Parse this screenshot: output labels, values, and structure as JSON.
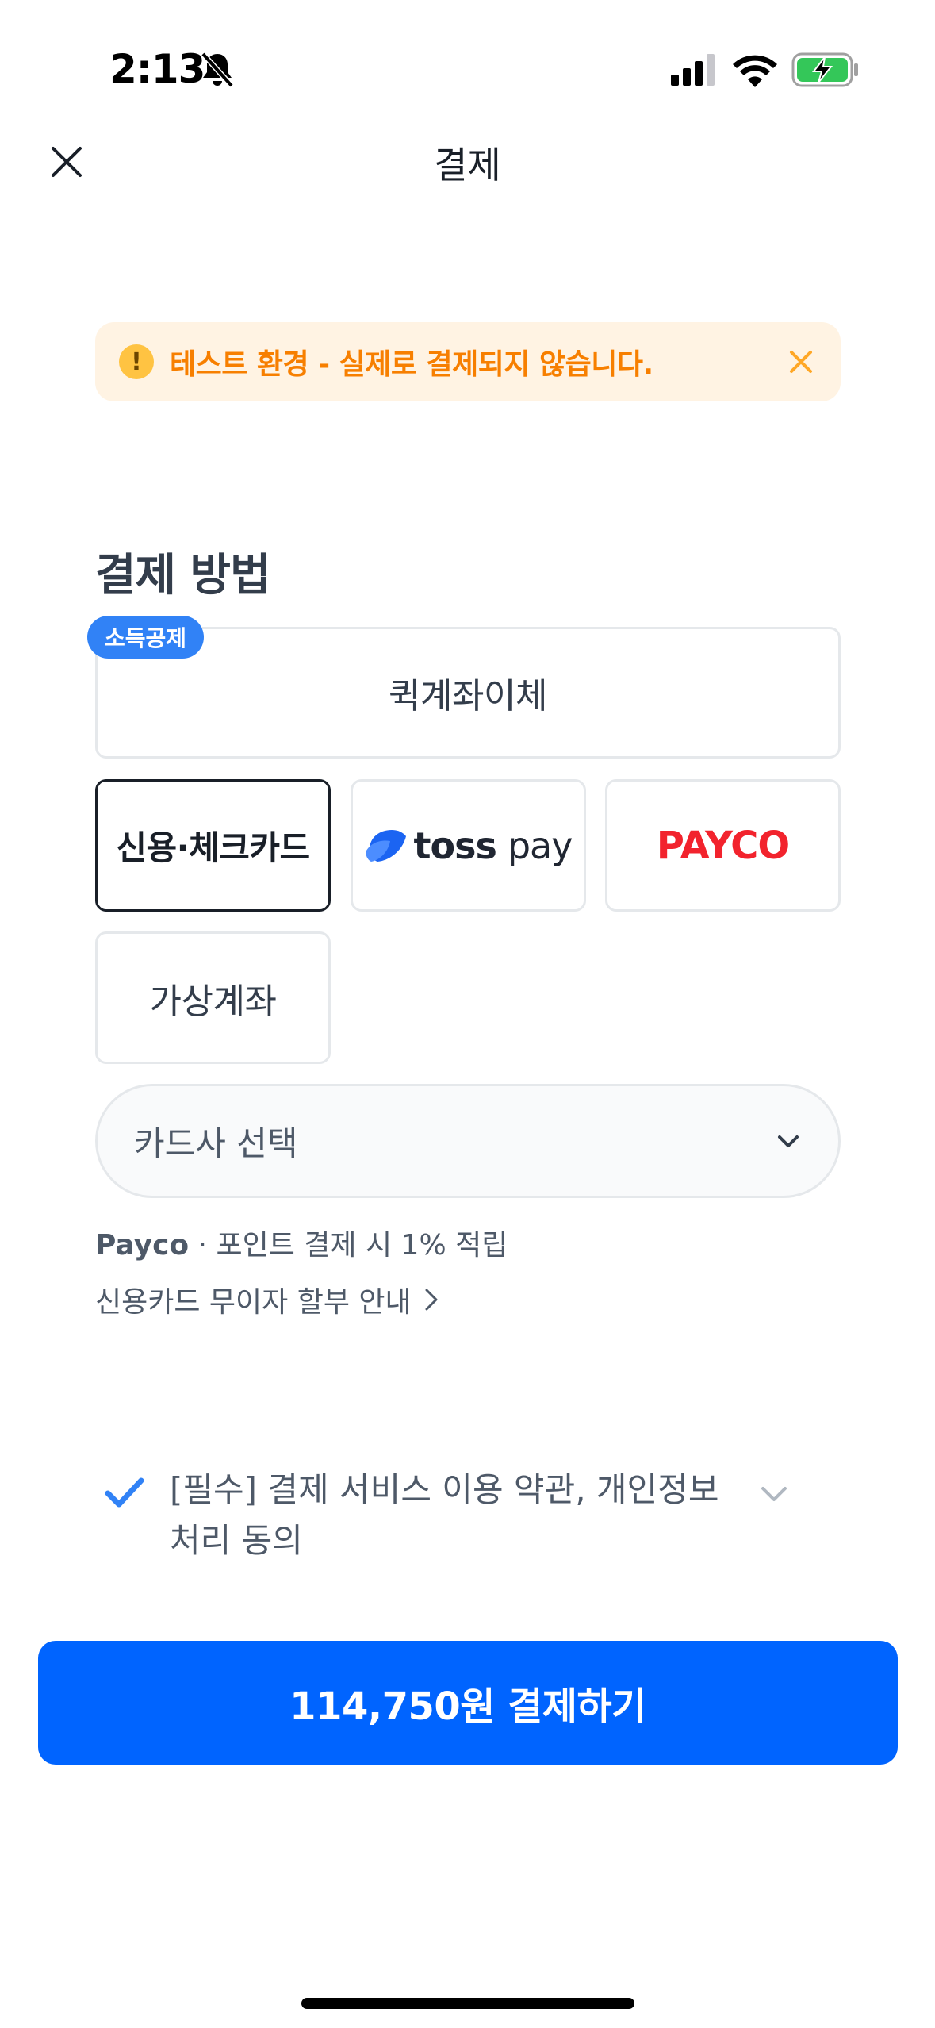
{
  "status_bar": {
    "time": "2:13"
  },
  "header": {
    "title": "결제"
  },
  "banner": {
    "text": "테스트 환경 - 실제로 결제되지 않습니다.",
    "warn_symbol": "!"
  },
  "payment": {
    "section_title": "결제 방법",
    "badge": "소득공제",
    "methods": {
      "quick": "퀵계좌이체",
      "card": "신용·체크카드",
      "tosspay_bold": "toss",
      "tosspay_light": "pay",
      "payco": "PAYCO",
      "virtual_account": "가상계좌"
    },
    "card_select_placeholder": "카드사 선택",
    "info_brand": "Payco",
    "info_text": " · 포인트 결제 시 1% 적립",
    "installment_link": "신용카드 무이자 할부 안내"
  },
  "agreement": {
    "text": "[필수] 결제 서비스 이용 약관, 개인정보 처리 동의"
  },
  "pay_button": {
    "label": "114,750원 결제하기"
  },
  "colors": {
    "primary": "#0064ff",
    "badge": "#3182f6",
    "warning_text": "#f77f00",
    "warning_bg": "#fff3e3",
    "payco_red": "#f2232d"
  },
  "icons": [
    "bell-slash-icon",
    "signal-icon",
    "wifi-icon",
    "battery-charging-icon",
    "close-icon",
    "warning-icon",
    "banner-close-icon",
    "tosspay-logo-icon",
    "chevron-down-icon",
    "chevron-right-icon",
    "check-icon"
  ]
}
